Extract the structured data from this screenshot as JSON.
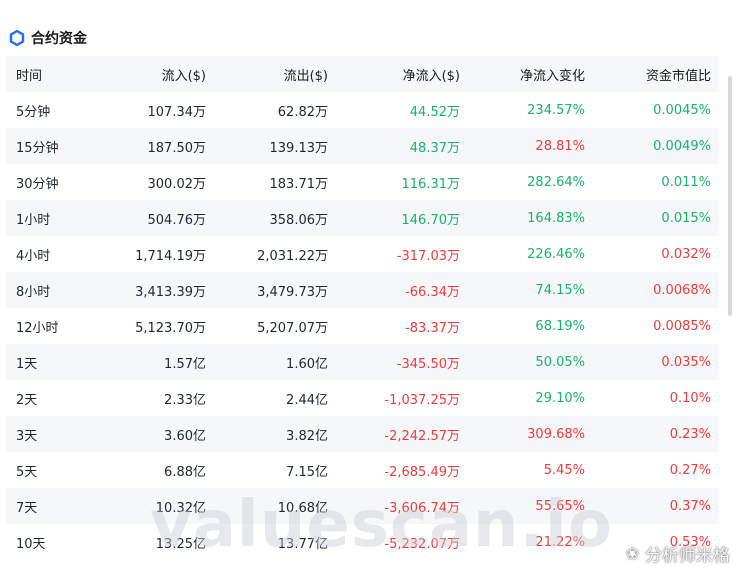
{
  "panel": {
    "title": "合约资金"
  },
  "table": {
    "headers": [
      "时间",
      "流入($)",
      "流出($)",
      "净流入($)",
      "净流入变化",
      "资金市值比"
    ],
    "rows": [
      {
        "period": "5分钟",
        "inflow": "107.34万",
        "outflow": "62.82万",
        "net": "44.52万",
        "net_sign": "pos",
        "change": "234.57%",
        "change_sign": "pos",
        "ratio": "0.0045%",
        "ratio_sign": "pos"
      },
      {
        "period": "15分钟",
        "inflow": "187.50万",
        "outflow": "139.13万",
        "net": "48.37万",
        "net_sign": "pos",
        "change": "28.81%",
        "change_sign": "neg",
        "ratio": "0.0049%",
        "ratio_sign": "pos"
      },
      {
        "period": "30分钟",
        "inflow": "300.02万",
        "outflow": "183.71万",
        "net": "116.31万",
        "net_sign": "pos",
        "change": "282.64%",
        "change_sign": "pos",
        "ratio": "0.011%",
        "ratio_sign": "pos"
      },
      {
        "period": "1小时",
        "inflow": "504.76万",
        "outflow": "358.06万",
        "net": "146.70万",
        "net_sign": "pos",
        "change": "164.83%",
        "change_sign": "pos",
        "ratio": "0.015%",
        "ratio_sign": "pos"
      },
      {
        "period": "4小时",
        "inflow": "1,714.19万",
        "outflow": "2,031.22万",
        "net": "-317.03万",
        "net_sign": "neg",
        "change": "226.46%",
        "change_sign": "pos",
        "ratio": "0.032%",
        "ratio_sign": "neg"
      },
      {
        "period": "8小时",
        "inflow": "3,413.39万",
        "outflow": "3,479.73万",
        "net": "-66.34万",
        "net_sign": "neg",
        "change": "74.15%",
        "change_sign": "pos",
        "ratio": "0.0068%",
        "ratio_sign": "neg"
      },
      {
        "period": "12小时",
        "inflow": "5,123.70万",
        "outflow": "5,207.07万",
        "net": "-83.37万",
        "net_sign": "neg",
        "change": "68.19%",
        "change_sign": "pos",
        "ratio": "0.0085%",
        "ratio_sign": "neg"
      },
      {
        "period": "1天",
        "inflow": "1.57亿",
        "outflow": "1.60亿",
        "net": "-345.50万",
        "net_sign": "neg",
        "change": "50.05%",
        "change_sign": "pos",
        "ratio": "0.035%",
        "ratio_sign": "neg"
      },
      {
        "period": "2天",
        "inflow": "2.33亿",
        "outflow": "2.44亿",
        "net": "-1,037.25万",
        "net_sign": "neg",
        "change": "29.10%",
        "change_sign": "pos",
        "ratio": "0.10%",
        "ratio_sign": "neg"
      },
      {
        "period": "3天",
        "inflow": "3.60亿",
        "outflow": "3.82亿",
        "net": "-2,242.57万",
        "net_sign": "neg",
        "change": "309.68%",
        "change_sign": "neg",
        "ratio": "0.23%",
        "ratio_sign": "neg"
      },
      {
        "period": "5天",
        "inflow": "6.88亿",
        "outflow": "7.15亿",
        "net": "-2,685.49万",
        "net_sign": "neg",
        "change": "5.45%",
        "change_sign": "neg",
        "ratio": "0.27%",
        "ratio_sign": "neg"
      },
      {
        "period": "7天",
        "inflow": "10.32亿",
        "outflow": "10.68亿",
        "net": "-3,606.74万",
        "net_sign": "neg",
        "change": "55.65%",
        "change_sign": "neg",
        "ratio": "0.37%",
        "ratio_sign": "neg"
      },
      {
        "period": "10天",
        "inflow": "13.25亿",
        "outflow": "13.77亿",
        "net": "-5,232.07万",
        "net_sign": "neg",
        "change": "21.22%",
        "change_sign": "neg",
        "ratio": "0.53%",
        "ratio_sign": "neg"
      }
    ]
  },
  "watermark": "valuescan.io",
  "credit": {
    "icon": "wechat-icon",
    "text": "分析师米格"
  },
  "colors": {
    "positive": "#17b26a",
    "negative": "#f03a3a",
    "accent": "#1f6bff",
    "row_alt": "#f6f7f9"
  }
}
